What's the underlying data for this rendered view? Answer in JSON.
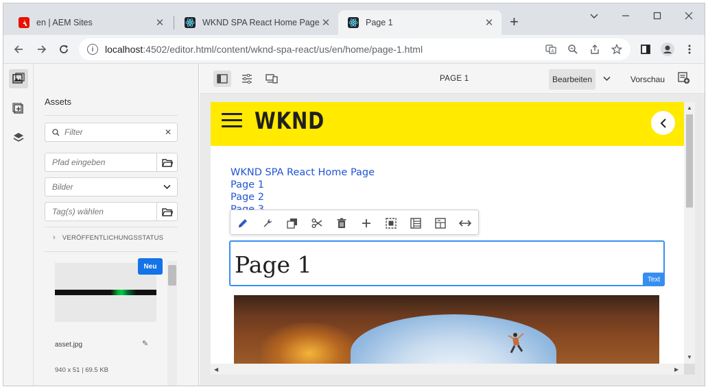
{
  "browser": {
    "tabs": [
      {
        "title": "en | AEM Sites",
        "icon": "adobe-icon",
        "active": false
      },
      {
        "title": "WKND SPA React Home Page",
        "icon": "react-icon",
        "active": false
      },
      {
        "title": "Page 1",
        "icon": "react-icon",
        "active": true
      }
    ],
    "new_tab": "+",
    "url_host": "localhost",
    "url_rest": ":4502/editor.html/content/wknd-spa-react/us/en/home/page-1.html"
  },
  "assets_panel": {
    "title": "Assets",
    "filter_placeholder": "Filter",
    "path_placeholder": "Pfad eingeben",
    "type_select_value": "Bilder",
    "tags_placeholder": "Tag(s) wählen",
    "publish_status_label": "VERÖFFENTLICHUNGSSTATUS",
    "card": {
      "badge": "Neu",
      "name": "asset.jpg",
      "meta": "940 x 51 | 69.5 KB"
    }
  },
  "editor": {
    "page_label": "PAGE 1",
    "mode_label": "Bearbeiten",
    "preview_label": "Vorschau"
  },
  "site": {
    "logo": "WKND",
    "nav_links": [
      "WKND SPA React Home Page",
      "Page 1",
      "Page 2",
      "Page 3"
    ],
    "heading": "Page 1",
    "component_label": "Text"
  },
  "colors": {
    "wknd_yellow": "#ffea00",
    "aem_blue": "#378ef0",
    "link_blue": "#2054d5",
    "badge_blue": "#1473e6"
  }
}
